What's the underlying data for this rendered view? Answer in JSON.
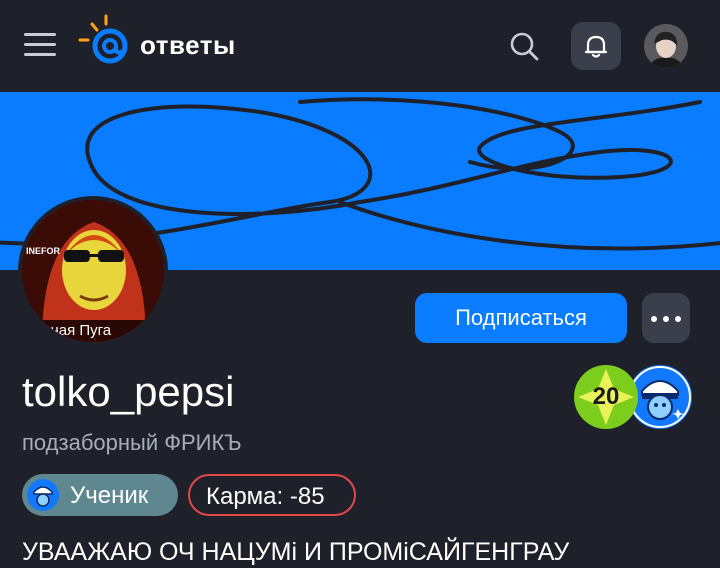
{
  "header": {
    "logo_text": "ответы",
    "icons": [
      "menu-icon",
      "search-icon",
      "bell-icon"
    ]
  },
  "colors": {
    "accent": "#0a7cff",
    "background": "#1e2129",
    "rank_badge": "#7dce1c",
    "karma_border": "#e2484a",
    "level_pill": "#5f8790",
    "logo_orange": "#ffa31a"
  },
  "profile": {
    "subscribe_label": "Подписаться",
    "username": "tolko_pepsi",
    "status": "подзаборный ФРИКЪ",
    "rank_number": "20",
    "level_label": "Ученик",
    "karma_label": "Карма:",
    "karma_value": "-85",
    "about": "УВААЖАЮ ОЧ НАЦУМi И ПРОМiСАЙГЕНГРАУ",
    "avatar_caption_top": "INEFOR",
    "avatar_caption_bottom": "ченная Пуга"
  }
}
